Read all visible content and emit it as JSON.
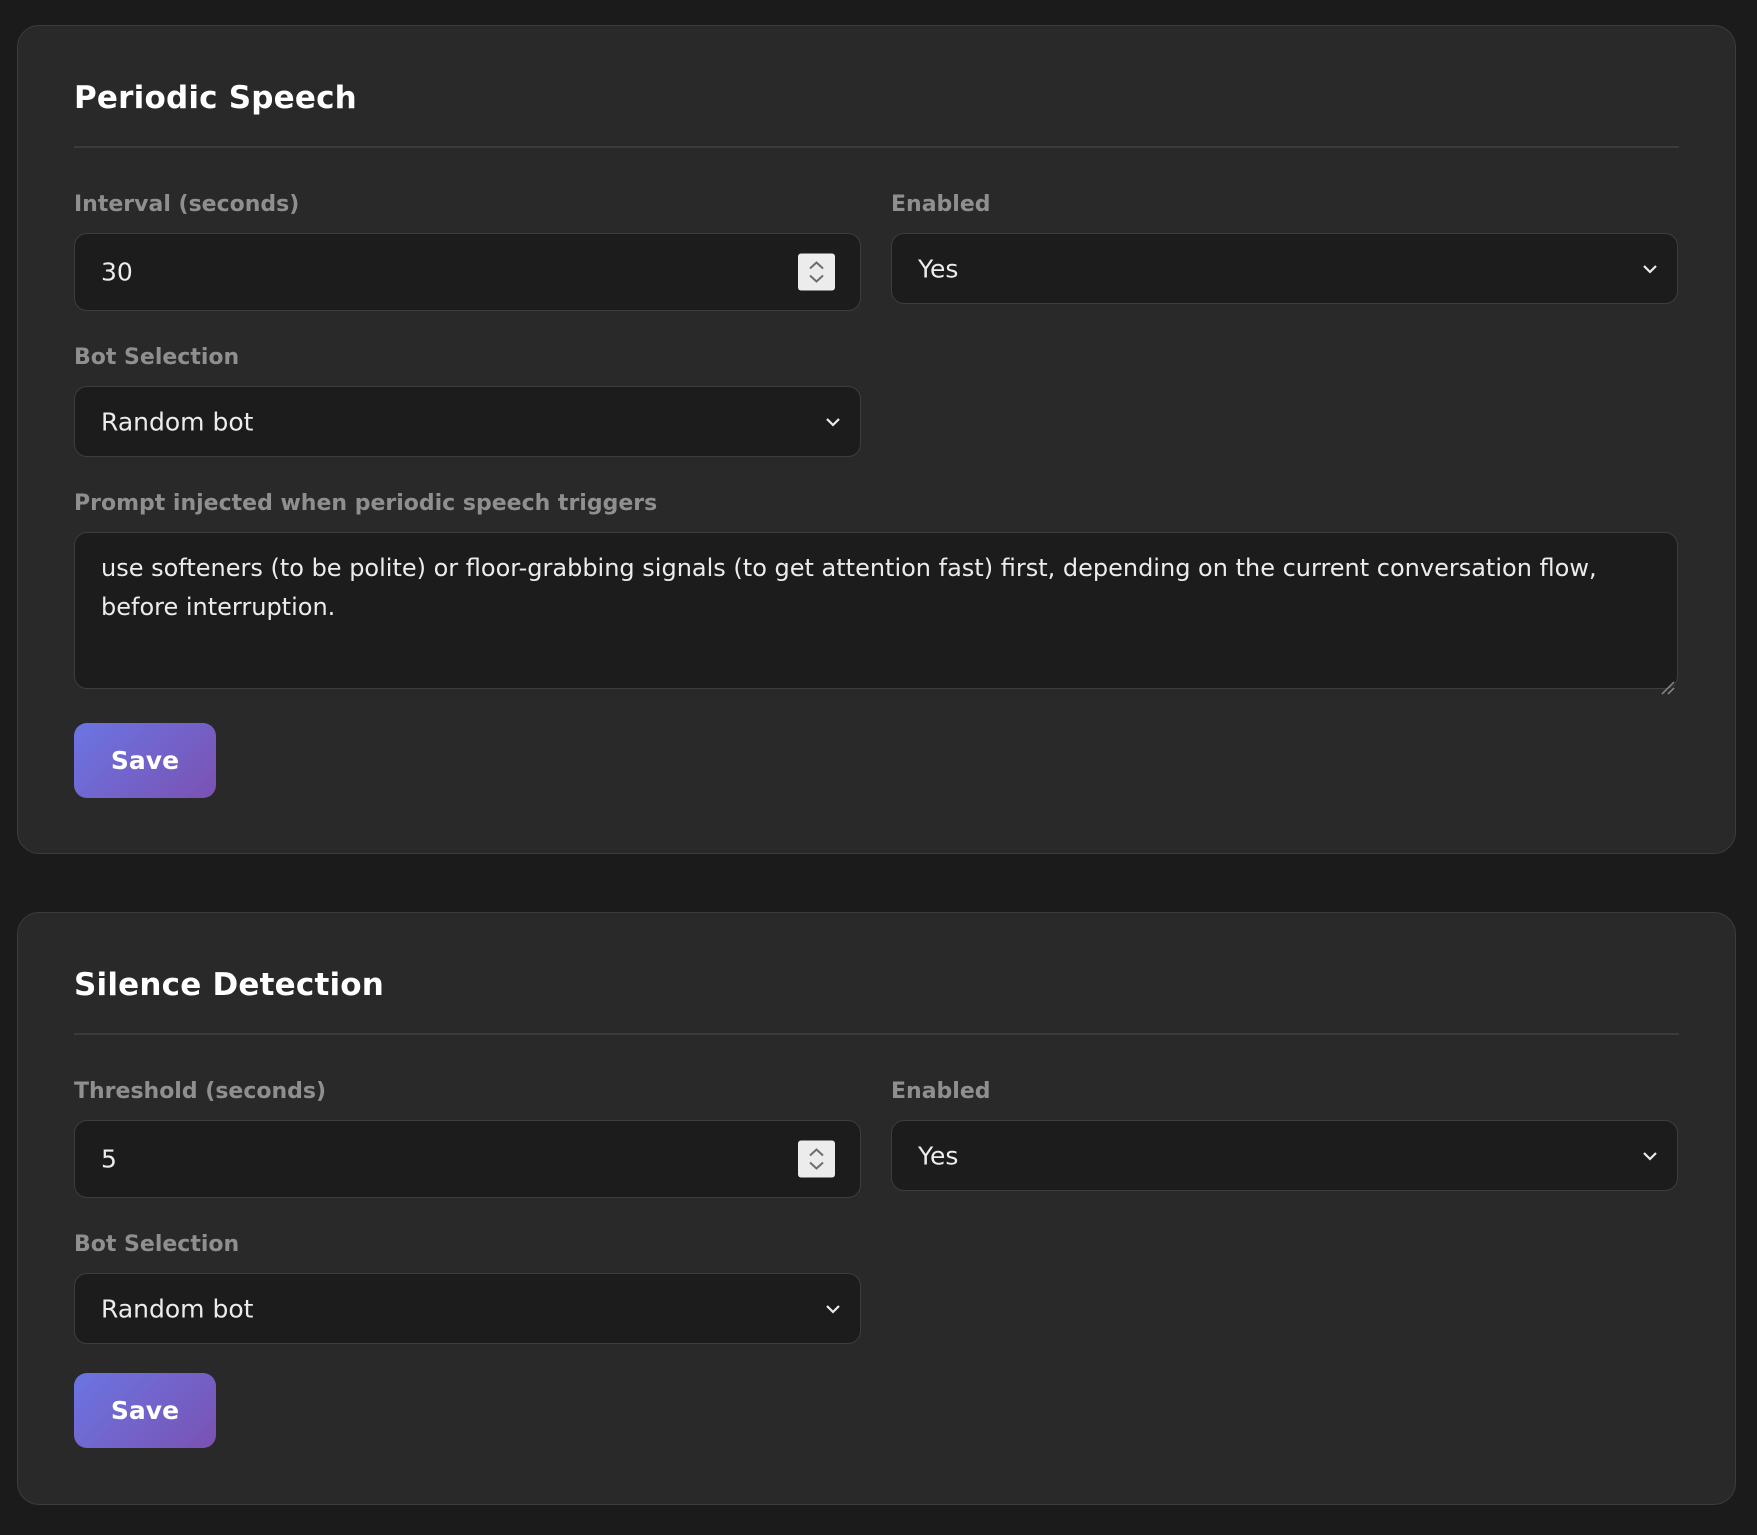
{
  "periodic_speech": {
    "title": "Periodic Speech",
    "interval_label": "Interval (seconds)",
    "interval_value": "30",
    "enabled_label": "Enabled",
    "enabled_value": "Yes",
    "bot_selection_label": "Bot Selection",
    "bot_selection_value": "Random bot",
    "prompt_label": "Prompt injected when periodic speech triggers",
    "prompt_value": "use softeners (to be polite) or floor-grabbing signals (to get attention fast) first, depending on the current conversation flow, before interruption.",
    "save_label": "Save"
  },
  "silence_detection": {
    "title": "Silence Detection",
    "threshold_label": "Threshold (seconds)",
    "threshold_value": "5",
    "enabled_label": "Enabled",
    "enabled_value": "Yes",
    "bot_selection_label": "Bot Selection",
    "bot_selection_value": "Random bot",
    "save_label": "Save"
  },
  "icons": {
    "spinner": "spinner-arrows-icon",
    "dropdown": "chevron-down-icon",
    "resize": "resize-grip-icon"
  },
  "colors": {
    "page_background": "#1b1b1b",
    "panel_background": "#292929",
    "input_background": "#1c1c1c",
    "label_text": "#8f8f8f",
    "button_gradient_start": "#6b75e3",
    "button_gradient_end": "#7a52b2"
  }
}
